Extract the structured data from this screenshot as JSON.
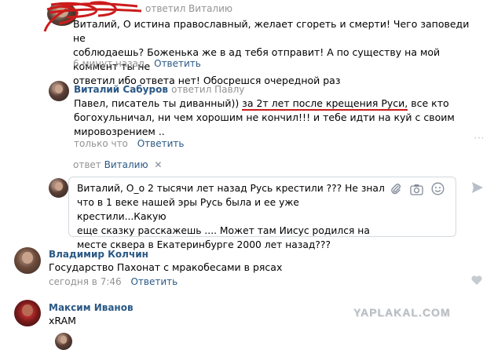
{
  "comment_top": {
    "author_hidden": "",
    "reply_to": "ответил Виталию",
    "lines": [
      "Виталий, О истина православный, желает сгореть и смерти! Чего заповеди не",
      "соблюдаешь? Боженька же в ад тебя отправит! А по существу на мой коммент ты не",
      "ответил ибо ответа нет! Обосрешся очередной раз"
    ],
    "time": "6 минут назад",
    "reply_label": "Ответить"
  },
  "comment_sabourov": {
    "author": "Виталий Сабуров",
    "reply_to": "ответил Павлу",
    "line1_a": "Павел, писатель ты диванный)) ",
    "line1_b": "за 2т лет после крещения Руси,",
    "line1_c": " все кто",
    "line2": "богохульничал, ни чем хорошим не кончил!!! и тебе идти на куй с своим",
    "line3": "мировозрением ..",
    "time": "только что",
    "reply_label": "Ответить"
  },
  "reply_target": {
    "prefix": "ответ",
    "name": "Виталию",
    "close": "✕"
  },
  "reply_box": {
    "lines": [
      "Виталий, О_о 2 тысячи лет назад Русь крестили ??? Не  знал",
      "что в 1 веке нашей эры Русь была и ее уже крестили...Какую",
      "еще сказку расскажешь .... Может там Иисус родился на",
      "месте сквера в Екатеринбурге 2000 лет назад???"
    ],
    "icons": [
      "paperclip-icon",
      "camera-icon",
      "smile-icon",
      "send-icon"
    ]
  },
  "comment_kolchin": {
    "author": "Владимир Колчин",
    "text": "Государство Пахонат с мракобесами в рясах",
    "time": "сегодня в 7:46",
    "reply_label": "Ответить"
  },
  "comment_ivanov": {
    "author": "Максим Иванов",
    "text": "xRAM"
  },
  "watermark": "YAPLAKAL.COM",
  "colors": {
    "link": "#2a5885",
    "meta": "#939393",
    "scribble": "#cc1b1b",
    "border": "#d3d9de"
  }
}
